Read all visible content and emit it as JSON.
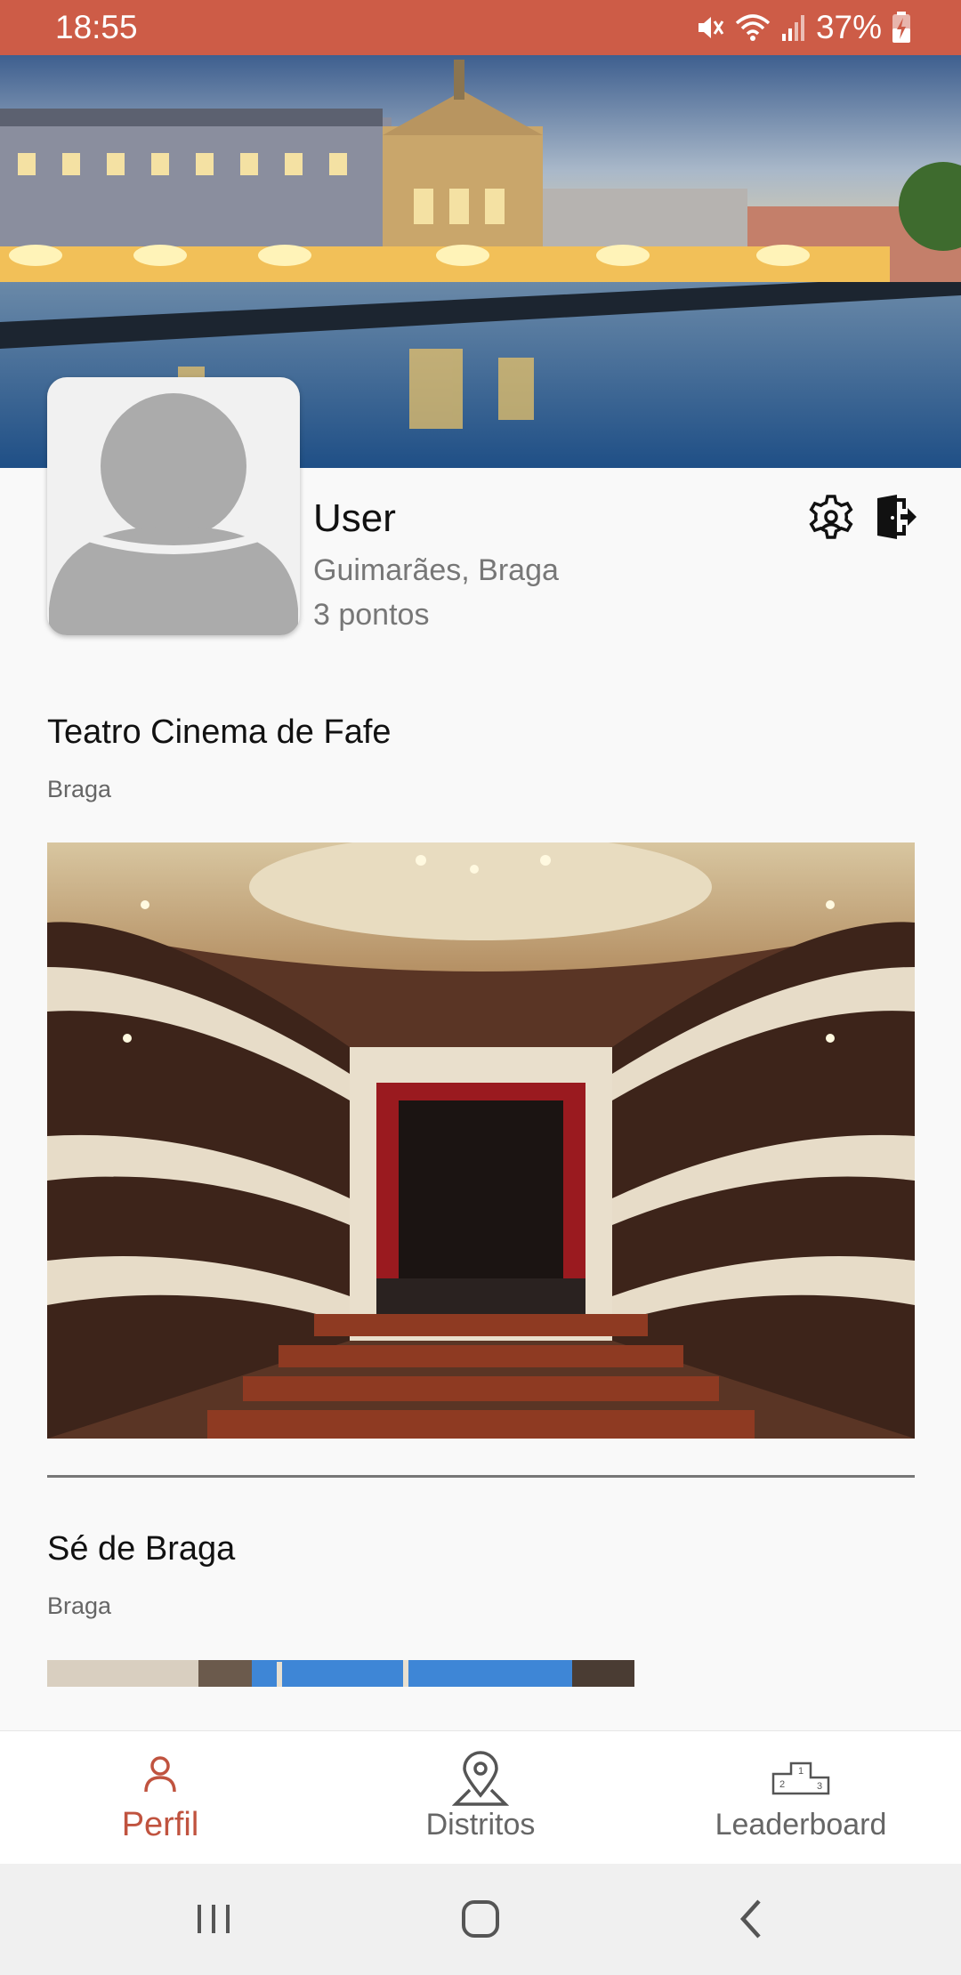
{
  "status_bar": {
    "time": "18:55",
    "battery": "37%",
    "color": "#cd5c47"
  },
  "profile": {
    "name": "User",
    "location": "Guimarães, Braga",
    "points": "3 pontos",
    "settings_icon": "settings-gear-icon",
    "logout_icon": "logout-icon"
  },
  "visited": [
    {
      "title": "Teatro Cinema de Fafe",
      "district": "Braga"
    },
    {
      "title": "Sé de Braga",
      "district": "Braga"
    }
  ],
  "bottom_nav": {
    "items": [
      {
        "label": "Perfil",
        "icon": "person-icon",
        "active": true
      },
      {
        "label": "Distritos",
        "icon": "map-pin-icon",
        "active": false
      },
      {
        "label": "Leaderboard",
        "icon": "podium-icon",
        "active": false
      }
    ],
    "active_color": "#c0533f"
  }
}
